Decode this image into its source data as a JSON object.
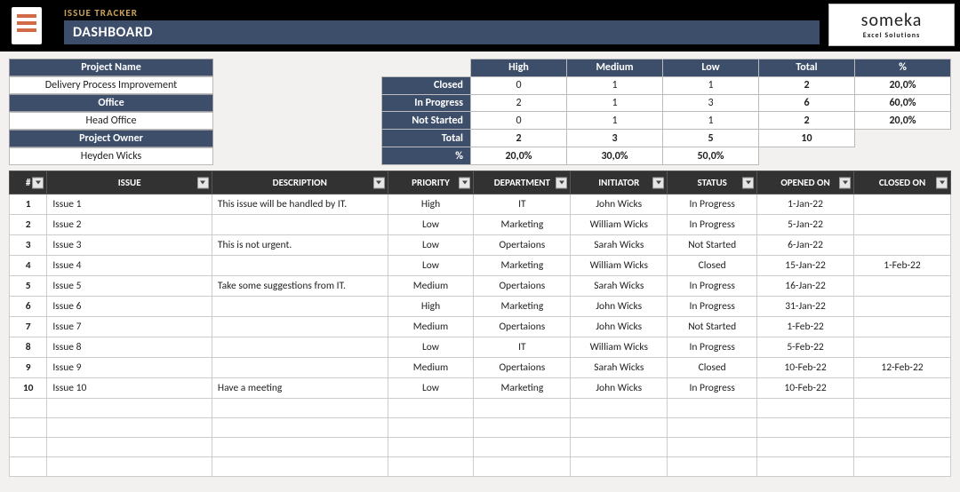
{
  "header": {
    "app_title": "ISSUE TRACKER",
    "page_title": "DASHBOARD",
    "logo_brand": "someka",
    "logo_sub": "Excel Solutions"
  },
  "info": {
    "project_name_label": "Project Name",
    "project_name": "Delivery Process Improvement",
    "office_label": "Office",
    "office": "Head Office",
    "project_owner_label": "Project Owner",
    "project_owner": "Heyden Wicks"
  },
  "summary": {
    "cols": [
      "High",
      "Medium",
      "Low",
      "Total",
      "%"
    ],
    "rows": [
      {
        "label": "Closed",
        "cells": [
          "0",
          "1",
          "1",
          "2",
          "20,0%"
        ]
      },
      {
        "label": "In Progress",
        "cells": [
          "2",
          "1",
          "3",
          "6",
          "60,0%"
        ]
      },
      {
        "label": "Not Started",
        "cells": [
          "0",
          "1",
          "1",
          "2",
          "20,0%"
        ]
      },
      {
        "label": "Total",
        "cells": [
          "2",
          "3",
          "5",
          "10",
          ""
        ]
      },
      {
        "label": "%",
        "cells": [
          "20,0%",
          "30,0%",
          "50,0%",
          "",
          ""
        ]
      }
    ]
  },
  "columns": [
    "#",
    "ISSUE",
    "DESCRIPTION",
    "PRIORITY",
    "DEPARTMENT",
    "INITIATOR",
    "STATUS",
    "OPENED ON",
    "CLOSED ON"
  ],
  "issues": [
    {
      "n": "1",
      "issue": "Issue 1",
      "desc": "This issue will be handled by IT.",
      "priority": "High",
      "dept": "IT",
      "init": "John Wicks",
      "status": "In Progress",
      "opened": "1-Jan-22",
      "closed": ""
    },
    {
      "n": "2",
      "issue": "Issue 2",
      "desc": "",
      "priority": "Low",
      "dept": "Marketing",
      "init": "William Wicks",
      "status": "In Progress",
      "opened": "5-Jan-22",
      "closed": ""
    },
    {
      "n": "3",
      "issue": "Issue 3",
      "desc": "This is not urgent.",
      "priority": "Low",
      "dept": "Opertaions",
      "init": "Sarah  Wicks",
      "status": "Not Started",
      "opened": "6-Jan-22",
      "closed": ""
    },
    {
      "n": "4",
      "issue": "Issue 4",
      "desc": "",
      "priority": "Low",
      "dept": "Marketing",
      "init": "William Wicks",
      "status": "Closed",
      "opened": "15-Jan-22",
      "closed": "1-Feb-22"
    },
    {
      "n": "5",
      "issue": "Issue 5",
      "desc": "Take some suggestions from IT.",
      "priority": "Medium",
      "dept": "Opertaions",
      "init": "Sarah  Wicks",
      "status": "In Progress",
      "opened": "16-Jan-22",
      "closed": ""
    },
    {
      "n": "6",
      "issue": "Issue 6",
      "desc": "",
      "priority": "High",
      "dept": "Marketing",
      "init": "John Wicks",
      "status": "In Progress",
      "opened": "31-Jan-22",
      "closed": ""
    },
    {
      "n": "7",
      "issue": "Issue 7",
      "desc": "",
      "priority": "Medium",
      "dept": "Opertaions",
      "init": "John Wicks",
      "status": "Not Started",
      "opened": "1-Feb-22",
      "closed": ""
    },
    {
      "n": "8",
      "issue": "Issue 8",
      "desc": "",
      "priority": "Low",
      "dept": "IT",
      "init": "William Wicks",
      "status": "In Progress",
      "opened": "5-Feb-22",
      "closed": ""
    },
    {
      "n": "9",
      "issue": "Issue 9",
      "desc": "",
      "priority": "Medium",
      "dept": "Opertaions",
      "init": "Sarah  Wicks",
      "status": "Closed",
      "opened": "10-Feb-22",
      "closed": "12-Feb-22"
    },
    {
      "n": "10",
      "issue": "Issue 10",
      "desc": "Have a meeting",
      "priority": "Low",
      "dept": "Marketing",
      "init": "John Wicks",
      "status": "In Progress",
      "opened": "10-Feb-22",
      "closed": ""
    }
  ],
  "empty_rows": 4
}
